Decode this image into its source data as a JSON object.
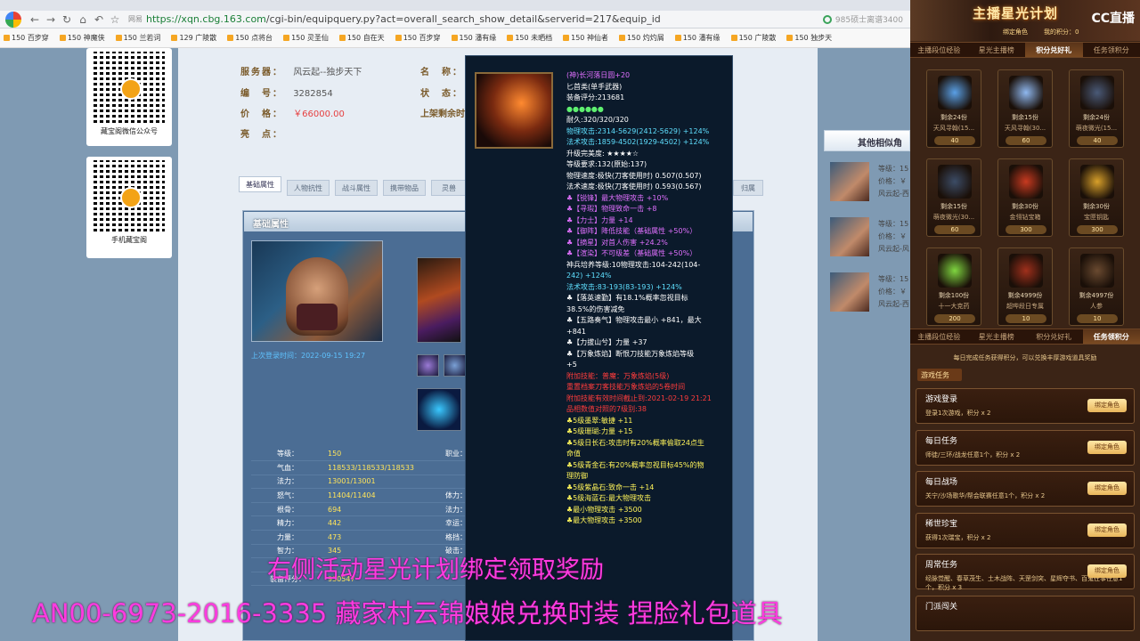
{
  "browser": {
    "url_site": "网易",
    "url_host": "https://xqn.cbg.163.com",
    "url_path": "/cgi-bin/equipquery.py?act=overall_search_show_detail&serverid=217&equip_id",
    "search_text": "985硕士离谱3400",
    "bookmarks": [
      "150 百步穿",
      "150 神魔侠",
      "150 兰若词",
      "129 广陵散",
      "150 点将台",
      "150 灵圣仙",
      "150 自在天",
      "150 百步穿",
      "150 潘有缘",
      "150 未晒档",
      "150 神仙者",
      "150 灼灼屑",
      "150 潘有缘",
      "150 广陵散",
      "150 独步天"
    ]
  },
  "qr": {
    "wechat": "藏宝阁微信公众号",
    "app": "手机藏宝阁"
  },
  "item": {
    "server_label": "服务器：",
    "server_value": "风云起--独步天下",
    "id_label": "编　号：",
    "id_value": "3282854",
    "price_label": "价　格：",
    "price_value": "￥66000.00",
    "highlight_label": "亮　点：",
    "name_label": "名　称：",
    "status_label": "状　态：",
    "remain_label": "上架剩余时"
  },
  "tabs": [
    "基础属性",
    "人物抗性",
    "战斗属性",
    "携带物品",
    "灵兽",
    "归属"
  ],
  "panel": {
    "title": "基础属性",
    "timestamp": "上次登录时间：2022-09-15 19:27"
  },
  "stats": [
    {
      "k": "等级：",
      "v": "150",
      "k2": "职业：",
      "v2": "斩"
    },
    {
      "k": "气血：",
      "v": "118533/118533/118533",
      "k2": "",
      "v2": ""
    },
    {
      "k": "法力：",
      "v": "13001/13001",
      "k2": "",
      "v2": ""
    },
    {
      "k": "怒气：",
      "v": "11404/11404",
      "k2": "体力：",
      "v2": "914"
    },
    {
      "k": "根骨：",
      "v": "694",
      "k2": "法力：",
      "v2": "914"
    },
    {
      "k": "精力：",
      "v": "442",
      "k2": "幸运：",
      "v2": "0"
    },
    {
      "k": "力量：",
      "v": "473",
      "k2": "格挡：",
      "v2": "585"
    },
    {
      "k": "智力：",
      "v": "345",
      "k2": "破击：",
      "v2": ""
    },
    {
      "k": "",
      "v": "",
      "k2": "",
      "v2": ""
    },
    {
      "k": "装备评分：",
      "v": "930547",
      "k2": "",
      "v2": ""
    }
  ],
  "tooltip": [
    {
      "t": "(神)长河落日圆+20",
      "c": "c-p"
    },
    {
      "t": "匕首类(单手武器)",
      "c": "c-w"
    },
    {
      "t": "装备评分:213681",
      "c": "c-w"
    },
    {
      "t": "●●●●●●",
      "c": "c-g"
    },
    {
      "t": "耐久:320/320/320",
      "c": "c-w"
    },
    {
      "t": "物理攻击:2314-5629(2412-5629) +124%",
      "c": "c-c"
    },
    {
      "t": "法术攻击:1859-4502(1929-4502) +124%",
      "c": "c-c"
    },
    {
      "t": "升级完美度: ★★★★☆",
      "c": "c-w"
    },
    {
      "t": "等级要求:132(原始:137)",
      "c": "c-w"
    },
    {
      "t": "",
      "c": "c-w"
    },
    {
      "t": "物理速度:极快(刀客使用时) 0.507(0.507)",
      "c": "c-w"
    },
    {
      "t": "法术速度:极快(刀客使用时) 0.593(0.567)",
      "c": "c-w"
    },
    {
      "t": "",
      "c": "c-w"
    },
    {
      "t": "",
      "c": "c-w"
    },
    {
      "t": "♣【锐锋】最大物理攻击 +10%",
      "c": "c-p"
    },
    {
      "t": "♣【寻瑕】物理致命一击 +8",
      "c": "c-p"
    },
    {
      "t": "♣【力士】力量 +14",
      "c": "c-p"
    },
    {
      "t": "♣【御阵】降低技能（基础属性 +50%）",
      "c": "c-p"
    },
    {
      "t": "♣【摘星】对首人伤害 +24.2%",
      "c": "c-p"
    },
    {
      "t": "♣【渲染】不可级差（基础属性 +50%）",
      "c": "c-p"
    },
    {
      "t": "",
      "c": "c-w"
    },
    {
      "t": "神兵培养等级:10物理攻击:104-242(104-",
      "c": "c-w"
    },
    {
      "t": "242) +124%",
      "c": "c-c"
    },
    {
      "t": "法术攻击:83-193(83-193) +124%",
      "c": "c-c"
    },
    {
      "t": "♣【落英速勤】有18.1%概率忽视目标",
      "c": "c-w"
    },
    {
      "t": "38.5%的伤害减免",
      "c": "c-w"
    },
    {
      "t": "♣【五路奏气】物理攻击最小 +841，最大",
      "c": "c-w"
    },
    {
      "t": "+841",
      "c": "c-w"
    },
    {
      "t": "♣【力拔山兮】力量 +37",
      "c": "c-w"
    },
    {
      "t": "♣【万象炼焰】断恨刀技能万象炼焰等级",
      "c": "c-w"
    },
    {
      "t": "+5",
      "c": "c-w"
    },
    {
      "t": "",
      "c": "c-w"
    },
    {
      "t": "附加技能：普魔：万象炼焰(5级)",
      "c": "c-r"
    },
    {
      "t": "重置档案刀客技能万象炼焰的5卷时间",
      "c": "c-r"
    },
    {
      "t": "附加技能有效时间截止到:2021-02-19 21:21",
      "c": "c-r"
    },
    {
      "t": "品相数值对照的7级别:38",
      "c": "c-r"
    },
    {
      "t": "♣5级墨翠:敏捷 +11",
      "c": "c-y"
    },
    {
      "t": "♣5级珊瑚:力量 +15",
      "c": "c-y"
    },
    {
      "t": "♣5级日长石:攻击时有20%概率偷取24点生",
      "c": "c-y"
    },
    {
      "t": "命值",
      "c": "c-y"
    },
    {
      "t": "♣5级青金石:有20%概率忽视目标45%的物",
      "c": "c-y"
    },
    {
      "t": "理防御",
      "c": "c-y"
    },
    {
      "t": "♣5级紫晶石:致命一击 +14",
      "c": "c-y"
    },
    {
      "t": "♣5级海蓝石:最大物理攻击",
      "c": "c-y"
    },
    {
      "t": "♣最小物理攻击 +3500",
      "c": "c-y"
    },
    {
      "t": "♣最大物理攻击 +3500",
      "c": "c-y"
    }
  ],
  "similar": {
    "title": "其他相似角",
    "items": [
      {
        "lv": "等级：15",
        "price": "价格：￥",
        "srv": "风云起-西"
      },
      {
        "lv": "等级：15",
        "price": "价格：￥",
        "srv": "风云起-风"
      },
      {
        "lv": "等级：15",
        "price": "价格：￥",
        "srv": "风云起-西"
      }
    ]
  },
  "streamer": {
    "title": "主播星光计划",
    "cc": "CC直播",
    "sub_left": "绑定角色",
    "sub_right": "我的积分：0",
    "tabs_top": [
      "主播段位经验",
      "星光主播榜",
      "积分兑好礼",
      "任务领积分"
    ],
    "tabs_top_active": 2,
    "shop": [
      {
        "cnt": "剩余24份",
        "nm": "天风寻翰(15...",
        "pr": "40",
        "col": "#5aa0e6"
      },
      {
        "cnt": "剩余15份",
        "nm": "天风寻翰(30...",
        "pr": "60",
        "col": "#8fb8f0"
      },
      {
        "cnt": "剩余24份",
        "nm": "萌夜微光(15...",
        "pr": "40",
        "col": "#4a5a78"
      },
      {
        "cnt": "剩余15份",
        "nm": "萌夜微光(30...",
        "pr": "60",
        "col": "#3c4c66"
      },
      {
        "cnt": "剩余30份",
        "nm": "金翎钻宝箱",
        "pr": "300",
        "col": "#c83a20"
      },
      {
        "cnt": "剩余30份",
        "nm": "宝匣钥匙",
        "pr": "300",
        "col": "#d8a02a"
      },
      {
        "cnt": "剩余100份",
        "nm": "十一大克药",
        "pr": "200",
        "col": "#7fd640"
      },
      {
        "cnt": "剩余4999份",
        "nm": "超哔段日专属",
        "pr": "10",
        "col": "#a0301c"
      },
      {
        "cnt": "剩余4997份",
        "nm": "人参",
        "pr": "10",
        "col": "#6a4a30"
      }
    ],
    "tabs_bottom": [
      "主播段位经验",
      "星光主播榜",
      "积分兑好礼",
      "任务领积分"
    ],
    "tabs_bottom_active": 3,
    "task_desc": "每日完成任务获得积分，可以兑换丰厚游戏道具奖励",
    "task_section": "游戏任务",
    "tasks": [
      {
        "n": "游戏登录",
        "d": "登录1次游戏，积分 x 2",
        "b": "绑定角色"
      },
      {
        "n": "每日任务",
        "d": "师徒/三环/战龙任意1个，积分 x 2",
        "b": "绑定角色"
      },
      {
        "n": "每日战场",
        "d": "关宁/沙场歌华/帮会联赛任意1个，积分 x 2",
        "b": "绑定角色"
      },
      {
        "n": "稀世珍宝",
        "d": "获得1次瑞宝，积分 x 2",
        "b": "绑定角色"
      },
      {
        "n": "周常任务",
        "d": "经脉觉醒、春草茂生、土木战阵、天罡剑突、星辉夺书、百鬼往事任意1个，积分 x 3",
        "b": "绑定角色"
      },
      {
        "n": "门派闯关",
        "d": "",
        "b": ""
      }
    ]
  },
  "overlay": {
    "line1": "右侧活动星光计划绑定领取奖励",
    "line2": "AN00-6973-2016-3335 藏家村云锦娘娘兑换时装 捏脸礼包道具"
  }
}
